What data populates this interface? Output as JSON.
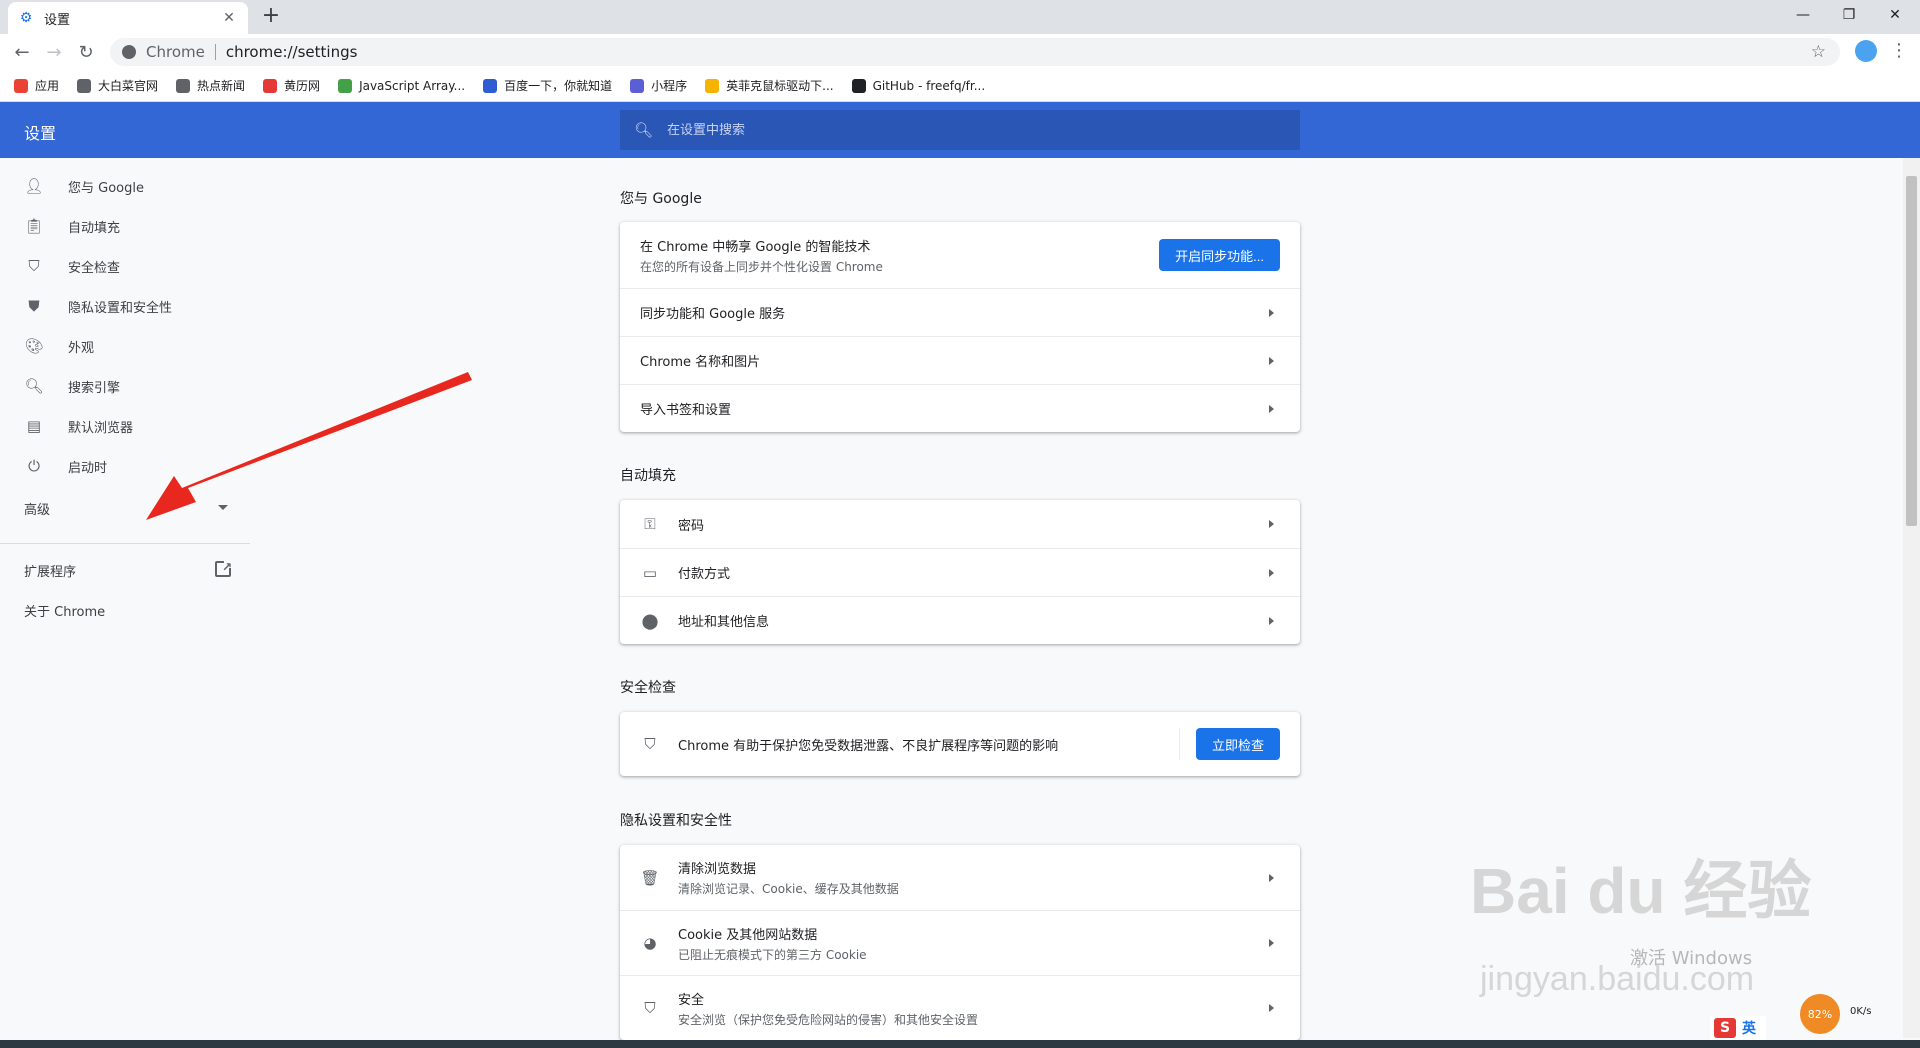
{
  "tab": {
    "title": "设置"
  },
  "omnibox": {
    "origin": "Chrome",
    "url": "chrome://settings"
  },
  "bookmarks": [
    {
      "label": "应用",
      "icon": "apps-icon",
      "color": "#ea4335"
    },
    {
      "label": "大白菜官网",
      "icon": "globe-icon",
      "color": "#5f6368"
    },
    {
      "label": "热点新闻",
      "icon": "globe-icon",
      "color": "#5f6368"
    },
    {
      "label": "黄历网",
      "icon": "calendar-icon",
      "color": "#e53935"
    },
    {
      "label": "JavaScript Array...",
      "icon": "site-icon",
      "color": "#43a047"
    },
    {
      "label": "百度一下，你就知道",
      "icon": "baidu-icon",
      "color": "#2f5bd3"
    },
    {
      "label": "小程序",
      "icon": "link-icon",
      "color": "#5b5fd6"
    },
    {
      "label": "英菲克鼠标驱动下...",
      "icon": "folder-icon",
      "color": "#f6b400"
    },
    {
      "label": "GitHub - freefq/fr...",
      "icon": "github-icon",
      "color": "#202124"
    }
  ],
  "header": {
    "title": "设置",
    "search_placeholder": "在设置中搜索"
  },
  "sidebar": {
    "items": [
      {
        "label": "您与 Google",
        "icon": "person-icon"
      },
      {
        "label": "自动填充",
        "icon": "clipboard-icon"
      },
      {
        "label": "安全检查",
        "icon": "shield-check-icon"
      },
      {
        "label": "隐私设置和安全性",
        "icon": "shield-icon"
      },
      {
        "label": "外观",
        "icon": "palette-icon"
      },
      {
        "label": "搜索引擎",
        "icon": "search-icon"
      },
      {
        "label": "默认浏览器",
        "icon": "browser-icon"
      },
      {
        "label": "启动时",
        "icon": "power-icon"
      }
    ],
    "advanced": "高级",
    "extensions": "扩展程序",
    "about": "关于 Chrome"
  },
  "main": {
    "you_google": {
      "title": "您与 Google",
      "sync_title": "在 Chrome 中畅享 Google 的智能技术",
      "sync_sub": "在您的所有设备上同步并个性化设置 Chrome",
      "sync_button": "开启同步功能...",
      "rows": [
        "同步功能和 Google 服务",
        "Chrome 名称和图片",
        "导入书签和设置"
      ]
    },
    "autofill": {
      "title": "自动填充",
      "rows": [
        {
          "label": "密码",
          "icon": "key-icon"
        },
        {
          "label": "付款方式",
          "icon": "credit-card-icon"
        },
        {
          "label": "地址和其他信息",
          "icon": "location-pin-icon"
        }
      ]
    },
    "safety": {
      "title": "安全检查",
      "text": "Chrome 有助于保护您免受数据泄露、不良扩展程序等问题的影响",
      "button": "立即检查"
    },
    "privacy": {
      "title": "隐私设置和安全性",
      "rows": [
        {
          "label": "清除浏览数据",
          "sub": "清除浏览记录、Cookie、缓存及其他数据",
          "icon": "trash-icon"
        },
        {
          "label": "Cookie 及其他网站数据",
          "sub": "已阻止无痕模式下的第三方 Cookie",
          "icon": "cookie-icon"
        },
        {
          "label": "安全",
          "sub": "安全浏览（保护您免受危险网站的侵害）和其他安全设置",
          "icon": "security-shield-icon"
        }
      ]
    }
  },
  "overlay": {
    "watermark": "Bai du 经验",
    "watermark_url": "jingyan.baidu.com",
    "activate": "激活 Windows",
    "ime_label": "英",
    "speed_percent": "82%",
    "speed_rate": "0K/s"
  }
}
